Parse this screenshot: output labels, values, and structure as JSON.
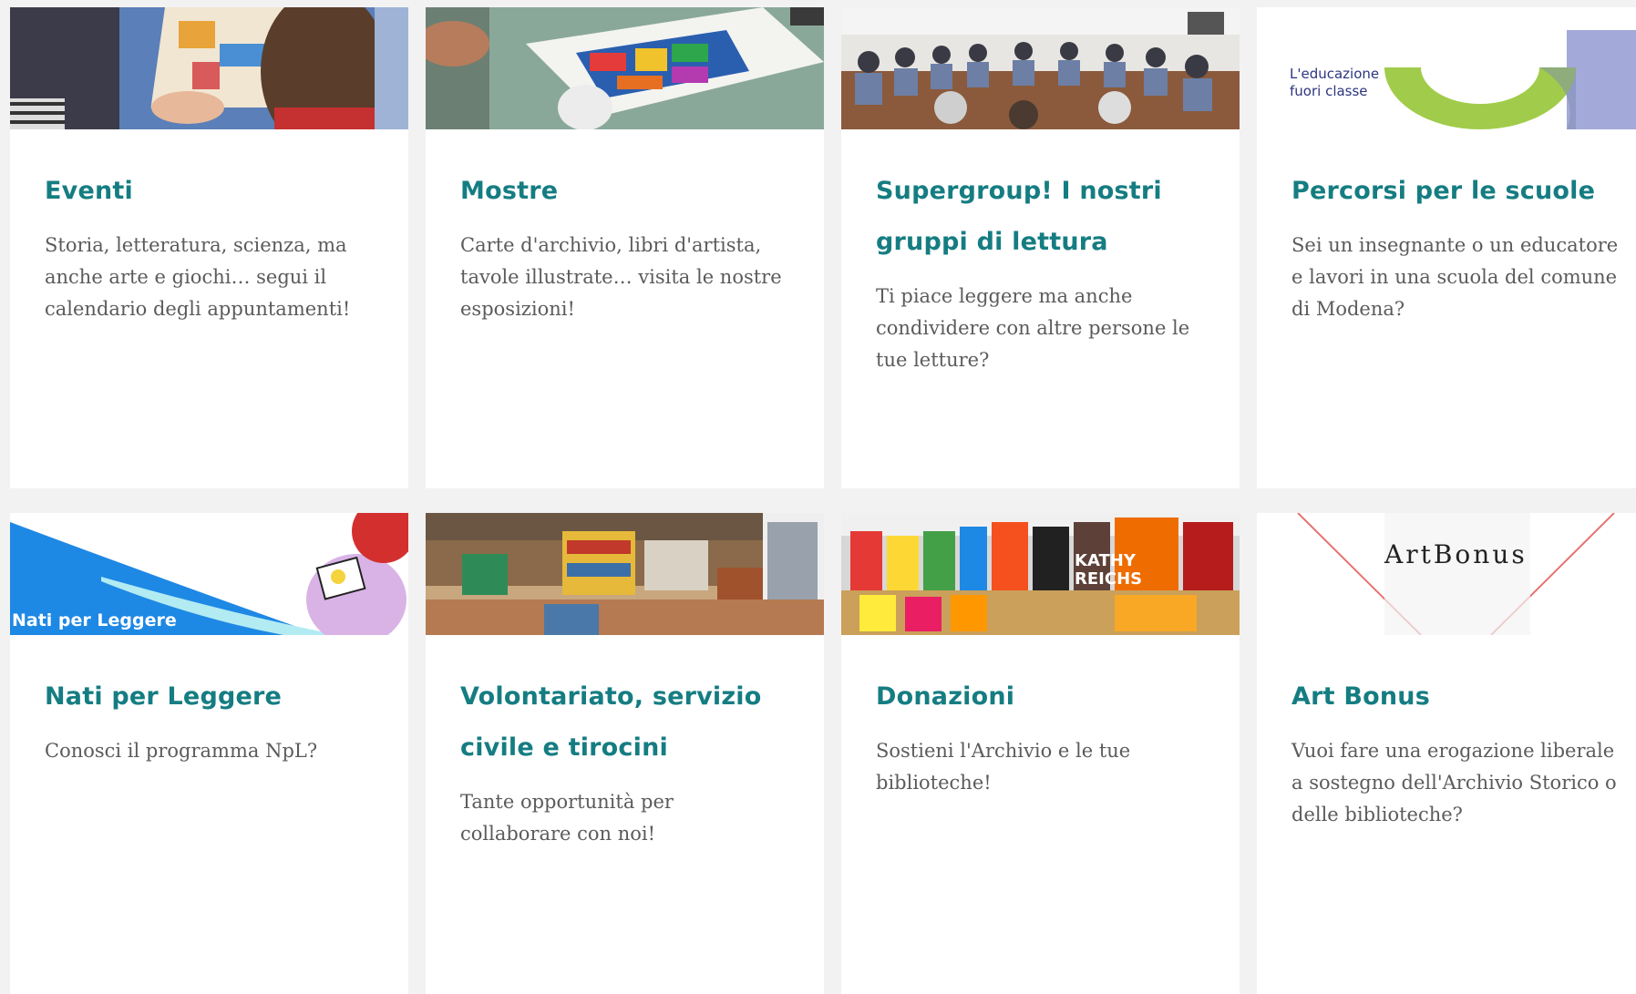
{
  "cards": [
    {
      "title": "Eventi",
      "desc": "Storia, letteratura, scienza, ma anche arte e giochi… segui il calendario degli appuntamenti!"
    },
    {
      "title": "Mostre",
      "desc": "Carte d'archivio, libri d'artista, tavole illustrate… visita le nostre esposizioni!"
    },
    {
      "title": "Supergroup! I nostri gruppi di lettura",
      "desc": "Ti piace leggere ma anche condividere con altre persone le tue letture?"
    },
    {
      "title": "Percorsi per le scuole",
      "desc": "Sei un insegnante o un educatore e lavori in una scuola del comune di Modena?",
      "image_text_line1": "L'educazione",
      "image_text_line2": "fuori classe"
    },
    {
      "title": "Nati per Leggere",
      "desc": "Conosci il programma NpL?",
      "image_text": "Nati per Leggere"
    },
    {
      "title": "Volontariato, servizio civile e tirocini",
      "desc": "Tante opportunità per collaborare con noi!"
    },
    {
      "title": "Donazioni",
      "desc": "Sostieni l'Archivio e le tue biblioteche!",
      "image_text_line1": "KATHY",
      "image_text_line2": "REICHS"
    },
    {
      "title": "Art Bonus",
      "desc": "Vuoi fare una erogazione liberale a sostegno dell'Archivio Storico o delle biblioteche?",
      "image_text": "ArtBonus"
    }
  ],
  "colors": {
    "title": "#157d82",
    "text": "#5b5b5b",
    "background": "#f2f2f2",
    "card": "#ffffff"
  }
}
